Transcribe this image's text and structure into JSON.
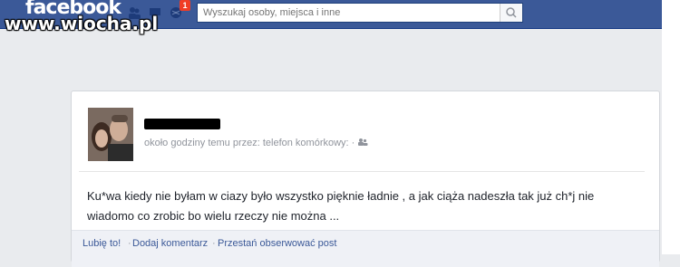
{
  "app": {
    "logo": "facebook",
    "notifications_count": "1"
  },
  "search": {
    "placeholder": "Wyszukaj osoby, miejsca i inne"
  },
  "watermark": "www.wiocha.pl",
  "post": {
    "meta": "około godziny temu przez: telefon komórkowy: ·",
    "text": "Ku*wa kiedy nie byłam w ciazy było wszystko pięknie ładnie , a jak ciąża nadeszła tak już ch*j nie wiadomo co zrobic bo wielu rzeczy nie można ..."
  },
  "actions": {
    "like": "Lubię to!",
    "comment": "Dodaj komentarz",
    "unfollow": "Przestań obserwować post",
    "separator": "·"
  },
  "colors": {
    "brand": "#3b5998",
    "link": "#3b5998",
    "badge": "#f03d25"
  },
  "icons": [
    "friends-icon",
    "messages-icon",
    "globe-notifications-icon",
    "search-icon",
    "audience-friends-icon"
  ]
}
